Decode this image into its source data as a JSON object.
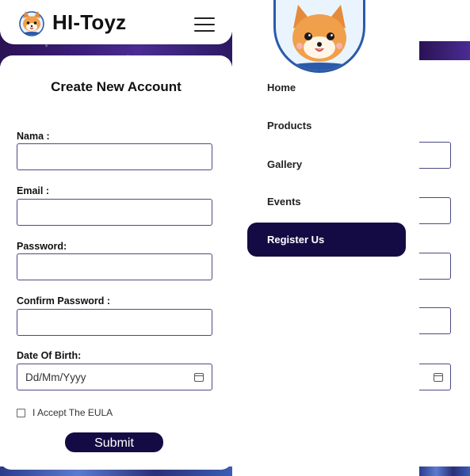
{
  "brand": {
    "title": "HI-Toyz"
  },
  "form": {
    "title": "Create New Account",
    "fields": [
      {
        "label": "Nama :",
        "value": ""
      },
      {
        "label": "Email :",
        "value": ""
      },
      {
        "label": "Password:",
        "value": ""
      },
      {
        "label": "Confirm Password :",
        "value": ""
      },
      {
        "label": "Date Of Birth:",
        "placeholder": "Dd/Mm/Yyyy"
      }
    ],
    "eula_label": "I Accept The EULA",
    "submit_label": "Submit"
  },
  "drawer": {
    "items": [
      {
        "label": "Home"
      },
      {
        "label": "Products"
      },
      {
        "label": "Gallery"
      },
      {
        "label": "Events"
      },
      {
        "label": "Register Us",
        "active": true
      }
    ]
  },
  "icons": {
    "menu": "hamburger-icon",
    "calendar": "calendar-icon",
    "logo": "shiba-dog-icon"
  },
  "colors": {
    "accent": "#150b44",
    "border": "#4b4a83",
    "galaxy": "#3b1e7a"
  }
}
